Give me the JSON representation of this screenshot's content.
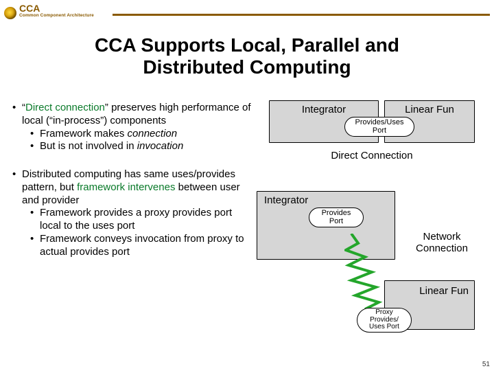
{
  "header": {
    "logo_abbrev": "CCA",
    "logo_sub": "Common Component Architecture"
  },
  "title_line1": "CCA Supports Local, Parallel and",
  "title_line2": "Distributed Computing",
  "bullet1": {
    "pre": "“",
    "green": "Direct connection",
    "post": "” preserves high performance of local (“in-process”) components",
    "sub1a": "Framework makes ",
    "sub1b": "connection",
    "sub2a": "But is not involved in ",
    "sub2b": "invocation"
  },
  "bullet2": {
    "a": "Distributed computing has same uses/provides pattern, but ",
    "green": "framework intervenes",
    "b": " between user and provider",
    "sub1": "Framework provides a proxy provides port local to the uses port",
    "sub2": "Framework conveys invocation from proxy to actual provides port"
  },
  "diagram1": {
    "boxA": "Integrator",
    "boxB": "Linear Fun",
    "pill": "Provides/Uses\nPort",
    "caption": "Direct Connection"
  },
  "diagram2": {
    "boxA": "Integrator",
    "pillA": "Provides\nPort",
    "boxB": "Linear Fun",
    "pillB": "Proxy\nProvides/\nUses Port",
    "net": "Network\nConnection"
  },
  "page_number": "51"
}
